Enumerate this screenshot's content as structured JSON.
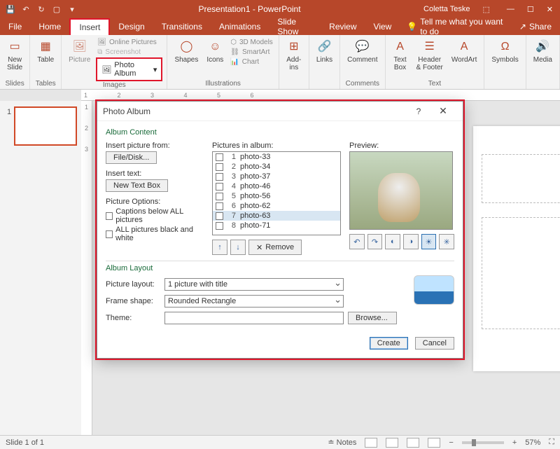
{
  "title": "Presentation1 - PowerPoint",
  "user": "Coletta Teske",
  "tabs": {
    "file": "File",
    "home": "Home",
    "insert": "Insert",
    "design": "Design",
    "transitions": "Transitions",
    "animations": "Animations",
    "slideshow": "Slide Show",
    "review": "Review",
    "view": "View",
    "tell": "Tell me what you want to do",
    "share": "Share"
  },
  "ribbon": {
    "newslide": "New\nSlide",
    "slides": "Slides",
    "table": "Table",
    "tables": "Tables",
    "pictures": "Picture",
    "online": "Online Pictures",
    "screenshot": "Screenshot",
    "photoalbum": "Photo Album",
    "images": "Images",
    "shapes": "Shapes",
    "icons": "Icons",
    "models": "3D Models",
    "smartart": "SmartArt",
    "chart": "Chart",
    "illustrations": "Illustrations",
    "addins": "Add-\nins",
    "links": "Links",
    "comment": "Comment",
    "comments": "Comments",
    "textbox": "Text\nBox",
    "header": "Header\n& Footer",
    "wordart": "WordArt",
    "text": "Text",
    "symbols": "Symbols",
    "media": "Media"
  },
  "thumb_num": "1",
  "status": {
    "slide": "Slide 1 of 1",
    "notes": "Notes",
    "zoom": "57%"
  },
  "dialog": {
    "title": "Photo Album",
    "album_content": "Album Content",
    "insert_from": "Insert picture from:",
    "file_disk": "File/Disk...",
    "insert_text": "Insert text:",
    "new_text_box": "New Text Box",
    "pic_options": "Picture Options:",
    "captions": "Captions below ALL pictures",
    "bw": "ALL pictures black and white",
    "pics_in_album": "Pictures in album:",
    "preview": "Preview:",
    "items": [
      {
        "n": "1",
        "name": "photo-33"
      },
      {
        "n": "2",
        "name": "photo-34"
      },
      {
        "n": "3",
        "name": "photo-37"
      },
      {
        "n": "4",
        "name": "photo-46"
      },
      {
        "n": "5",
        "name": "photo-56"
      },
      {
        "n": "6",
        "name": "photo-62"
      },
      {
        "n": "7",
        "name": "photo-63"
      },
      {
        "n": "8",
        "name": "photo-71"
      }
    ],
    "remove": "Remove",
    "album_layout": "Album Layout",
    "pic_layout_lbl": "Picture layout:",
    "pic_layout_val": "1 picture with title",
    "frame_lbl": "Frame shape:",
    "frame_val": "Rounded Rectangle",
    "theme_lbl": "Theme:",
    "browse": "Browse...",
    "create": "Create",
    "cancel": "Cancel"
  }
}
